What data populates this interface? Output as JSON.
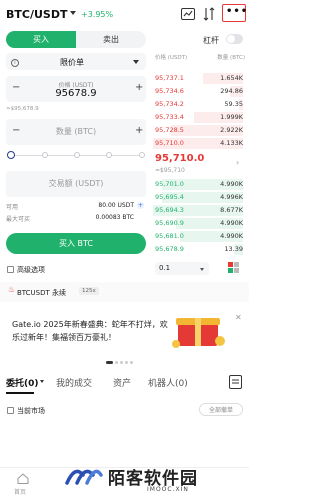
{
  "header": {
    "pair": "BTC/USDT",
    "change": "+3.95%",
    "icons": [
      "candlestick-chart-icon",
      "transfer-icon",
      "more-icon"
    ]
  },
  "trade_toggle": {
    "buy": "买入",
    "sell": "卖出",
    "active": "buy"
  },
  "leverage": {
    "label": "杠杆",
    "enabled": false
  },
  "order_form": {
    "order_type": "限价单",
    "price_label": "价格 (USDT)",
    "price_value": "95678.9",
    "price_approx": "≈$95,678.9",
    "quantity_placeholder": "数量 (BTC)",
    "slider_percent": 0,
    "amount_placeholder": "交易额 (USDT)",
    "available_label": "可用",
    "available_value": "80.00 USDT",
    "max_buy_label": "最大可买",
    "max_buy_value": "0.00083 BTC",
    "submit": "买入 BTC",
    "advanced_label": "高级选项"
  },
  "order_book": {
    "price_header": "价格 (USDT)",
    "qty_header": "数量 (BTC)",
    "asks": [
      {
        "price": "95,737.1",
        "qty": "1.654K",
        "depth": 0.45
      },
      {
        "price": "95,734.6",
        "qty": "294.86",
        "depth": 0.15
      },
      {
        "price": "95,734.2",
        "qty": "59.35",
        "depth": 0.05
      },
      {
        "price": "95,733.4",
        "qty": "1.999K",
        "depth": 0.55
      },
      {
        "price": "95,728.5",
        "qty": "2.922K",
        "depth": 0.8
      },
      {
        "price": "95,710.0",
        "qty": "4.133K",
        "depth": 1.0
      }
    ],
    "last_price": "95,710.0",
    "last_price_usd": "≈$95,710",
    "bids": [
      {
        "price": "95,701.0",
        "qty": "4.990K",
        "depth": 0.9
      },
      {
        "price": "95,695.4",
        "qty": "4.996K",
        "depth": 0.9
      },
      {
        "price": "95,694.3",
        "qty": "8.677K",
        "depth": 1.0
      },
      {
        "price": "95,690.9",
        "qty": "4.990K",
        "depth": 0.75
      },
      {
        "price": "95,681.0",
        "qty": "4.990K",
        "depth": 0.7
      },
      {
        "price": "95,678.9",
        "qty": "13.39",
        "depth": 0.1
      }
    ],
    "depth_step": "0.1"
  },
  "perp": {
    "name": "BTCUSDT 永续",
    "leverage": "125x"
  },
  "announcement": {
    "text": "Gate.io 2025年新春盛典：蛇年不打烊，欢乐过新年！集福领百万豪礼！",
    "slides": 5,
    "active_slide": 0
  },
  "tabs": [
    "委托(0)",
    "我的成交",
    "资产",
    "机器人(0)"
  ],
  "current_market_label": "当前市场",
  "cancel_all": "全部撤单",
  "bottom_nav": {
    "home": "首页"
  },
  "watermark": {
    "text": "陌客软件园",
    "sub": "IMOOC.XIN"
  },
  "colors": {
    "buy": "#20b26c",
    "sell": "#e53935",
    "highlight": "#e53935"
  }
}
